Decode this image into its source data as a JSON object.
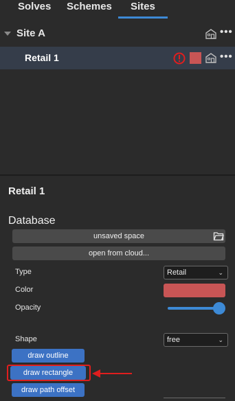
{
  "tabs": [
    {
      "label": "Solves"
    },
    {
      "label": "Schemes"
    },
    {
      "label": "Sites"
    }
  ],
  "tree": {
    "site": {
      "label": "Site A"
    },
    "child": {
      "label": "Retail 1",
      "color_swatch": "#c85555"
    }
  },
  "panel": {
    "title": "Retail 1",
    "section": "Database",
    "unsaved_space": "unsaved space",
    "open_from_cloud": "open from cloud...",
    "type_label": "Type",
    "type_value": "Retail",
    "color_label": "Color",
    "color_value": "#c85555",
    "opacity_label": "Opacity",
    "opacity_value": 1.0,
    "shape_label": "Shape",
    "shape_value": "free",
    "draw_outline": "draw outline",
    "draw_rectangle": "draw rectangle",
    "draw_path_offset": "draw path offset"
  },
  "colors": {
    "accent": "#3d8ad6",
    "button_blue": "#3c72c4",
    "annotation_red": "#e01e1e"
  },
  "icons": [
    "home-icon",
    "more-icon",
    "warning-icon",
    "open-file-icon",
    "chevron-down-icon"
  ]
}
